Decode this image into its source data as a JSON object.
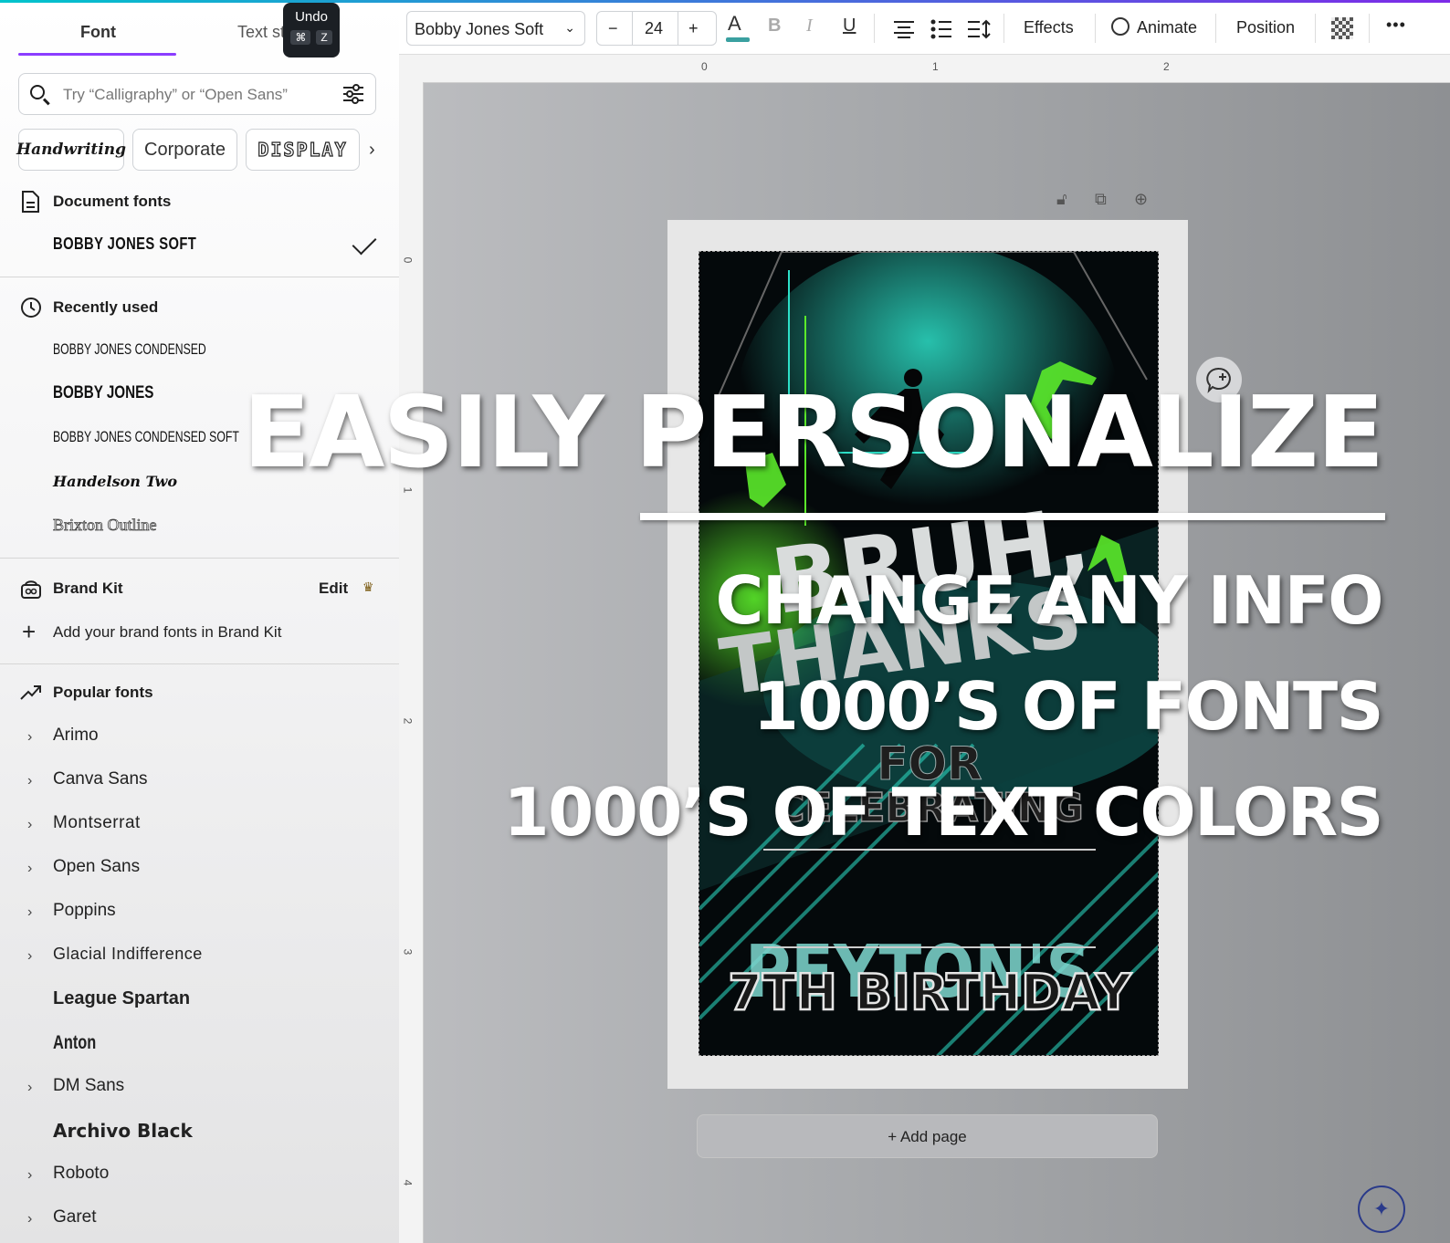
{
  "panel": {
    "tabs": {
      "font": "Font",
      "text_styles": "Text st"
    },
    "tooltip": {
      "label": "Undo",
      "key1": "⌘",
      "key2": "Z"
    },
    "search": {
      "placeholder": "Try “Calligraphy” or “Open Sans”"
    },
    "chips": {
      "handwriting": "Handwriting",
      "corporate": "Corporate",
      "display": "DISPLAY",
      "next": "›"
    },
    "document_fonts": {
      "heading": "Document fonts",
      "items": [
        "BOBBY JONES SOFT"
      ]
    },
    "recently_used": {
      "heading": "Recently used",
      "items": [
        "BOBBY JONES CONDENSED",
        "BOBBY JONES",
        "BOBBY JONES CONDENSED SOFT",
        "Handelson Two",
        "Brixton Outline"
      ]
    },
    "brand_kit": {
      "heading": "Brand Kit",
      "edit": "Edit",
      "add": "Add your brand fonts in Brand Kit"
    },
    "popular": {
      "heading": "Popular fonts",
      "items": [
        "Arimo",
        "Canva Sans",
        "Montserrat",
        "Open Sans",
        "Poppins",
        "Glacial Indifference",
        "League Spartan",
        "Anton",
        "DM Sans",
        "Archivo Black",
        "Roboto",
        "Garet"
      ]
    }
  },
  "toolbar": {
    "font_name": "Bobby Jones Soft",
    "font_size": "24",
    "minus": "−",
    "plus": "+",
    "color_letter": "A",
    "bold": "B",
    "italic": "I",
    "underline": "U",
    "effects": "Effects",
    "animate": "Animate",
    "position": "Position",
    "more": "•••"
  },
  "rulers": {
    "h": [
      "0",
      "1",
      "2"
    ],
    "v": [
      "0",
      "1",
      "2",
      "3",
      "4"
    ]
  },
  "poster": {
    "bruh": "BRUH,",
    "thanks": "THANKS",
    "for": "FOR",
    "celebrating": "CELEBRATING",
    "name": "PEYTON'S",
    "event": "7TH BIRTHDAY"
  },
  "canvas": {
    "add_page": "+ Add page"
  },
  "promo": {
    "headline": "EASILY PERSONALIZE",
    "line1": "CHANGE ANY INFO",
    "line2": "1000’S OF FONTS",
    "line3": "1000’S OF TEXT COLORS"
  },
  "colors": {
    "accent": "#8b3dff",
    "teal": "#00c4cc",
    "poster_teal": "#2de0c8",
    "poster_green": "#5bea2a"
  }
}
